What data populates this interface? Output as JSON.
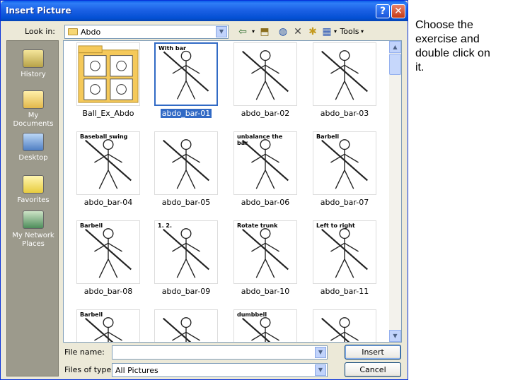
{
  "dialog": {
    "title": "Insert Picture",
    "help_button": "?",
    "close_button": "✕"
  },
  "lookin": {
    "label": "Look in:",
    "value": "Abdo"
  },
  "toolbar": {
    "back_icon": "back-arrow-icon",
    "up_icon": "up-folder-icon",
    "search_icon": "search-web-icon",
    "delete_icon": "delete-icon",
    "new_folder_icon": "new-folder-icon",
    "views_icon": "views-icon",
    "tools_label": "Tools"
  },
  "places": [
    {
      "label": "History",
      "icon": "history-icon"
    },
    {
      "label": "My Documents",
      "icon": "my-documents-icon"
    },
    {
      "label": "Desktop",
      "icon": "desktop-icon"
    },
    {
      "label": "Favorites",
      "icon": "favorites-icon"
    },
    {
      "label": "My Network Places",
      "icon": "network-places-icon"
    }
  ],
  "files": [
    {
      "name": "Ball_Ex_Abdo",
      "kind": "folder"
    },
    {
      "name": "abdo_bar-01",
      "caption": "With bar",
      "selected": true
    },
    {
      "name": "abdo_bar-02"
    },
    {
      "name": "abdo_bar-03"
    },
    {
      "name": "abdo_bar-04",
      "caption": "Baseball swing"
    },
    {
      "name": "abdo_bar-05"
    },
    {
      "name": "abdo_bar-06",
      "caption": "unbalance the bar"
    },
    {
      "name": "abdo_bar-07",
      "caption": "Barbell"
    },
    {
      "name": "abdo_bar-08",
      "caption": "Barbell"
    },
    {
      "name": "abdo_bar-09",
      "caption": "1.  2."
    },
    {
      "name": "abdo_bar-10",
      "caption": "Rotate trunk"
    },
    {
      "name": "abdo_bar-11",
      "caption": "Left to right"
    },
    {
      "name": "",
      "caption": "Barbell"
    },
    {
      "name": ""
    },
    {
      "name": "",
      "caption": "dumbbell"
    },
    {
      "name": ""
    }
  ],
  "filename": {
    "label": "File name:",
    "value": ""
  },
  "filetype": {
    "label": "Files of type:",
    "value": "All Pictures"
  },
  "buttons": {
    "insert": "Insert",
    "cancel": "Cancel"
  },
  "instruction": "Choose the exercise and double click on it.",
  "colors": {
    "titlebar": "#0a5ce8",
    "selection": "#316ac5",
    "dialog_bg": "#ece9d8"
  }
}
